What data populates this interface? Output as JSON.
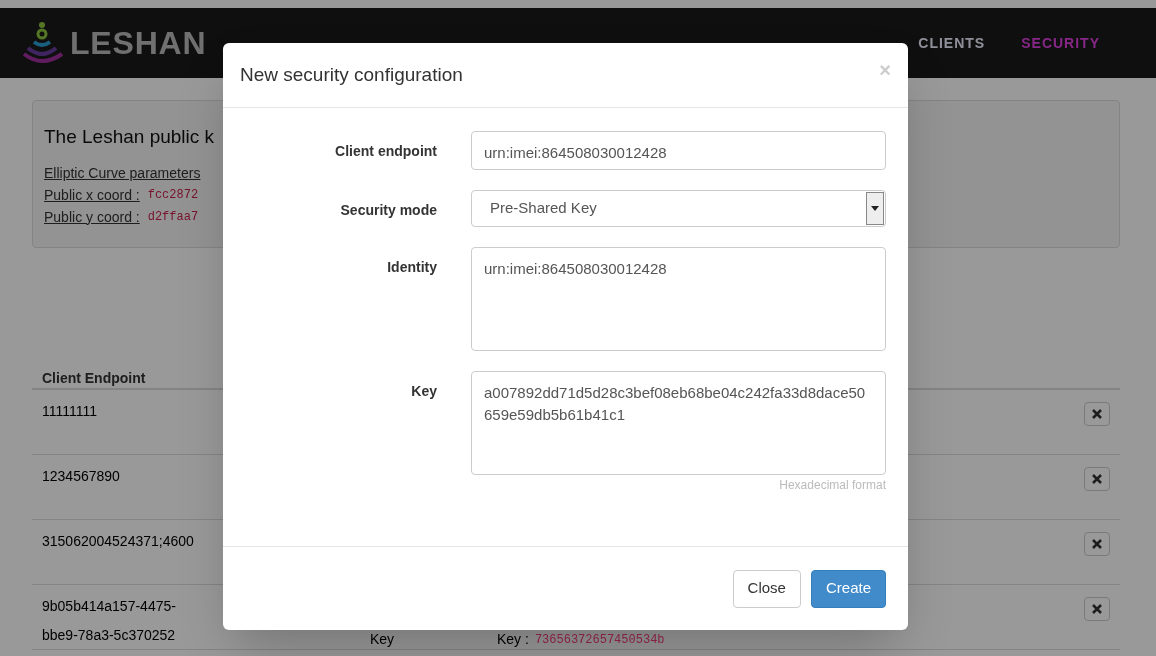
{
  "navbar": {
    "brand": "LESHAN",
    "links": [
      {
        "label": "CLIENTS",
        "selected": false
      },
      {
        "label": "SECURITY",
        "selected": true
      }
    ]
  },
  "panel": {
    "title": "The Leshan public k",
    "lines": [
      {
        "label": "Elliptic Curve parameters"
      },
      {
        "label": "Public x coord :",
        "value": "fcc2872"
      },
      {
        "label": "Public y coord :",
        "value": "d2ffaa7"
      }
    ]
  },
  "table": {
    "columns": [
      "Client Endpoint"
    ],
    "rows": [
      {
        "endpoint": "11111111"
      },
      {
        "endpoint": "1234567890"
      },
      {
        "endpoint": "315062004524371;4600"
      },
      {
        "endpoint": "9b05b414a157-4475-bbe9-78a3-5c370252",
        "mode": "Key",
        "key_label": "Key :",
        "key_value": "73656372657450534b"
      }
    ]
  },
  "dialog": {
    "title": "New security configuration",
    "close": "×",
    "fields": [
      {
        "kind": "input",
        "label": "Client endpoint",
        "value": "urn:imei:864508030012428"
      },
      {
        "kind": "select",
        "label": "Security mode",
        "value": "Pre-Shared Key"
      },
      {
        "kind": "textarea",
        "label": "Identity",
        "value": "urn:imei:864508030012428"
      },
      {
        "kind": "textarea",
        "label": "Key",
        "value": "a007892dd71d5d28c3bef08eb68be04c242fa33d8dace50659e59db5b61b41c1",
        "help": "Hexadecimal format"
      }
    ],
    "buttons": [
      {
        "label": "Close",
        "primary": false
      },
      {
        "label": "Create",
        "primary": true
      }
    ]
  }
}
